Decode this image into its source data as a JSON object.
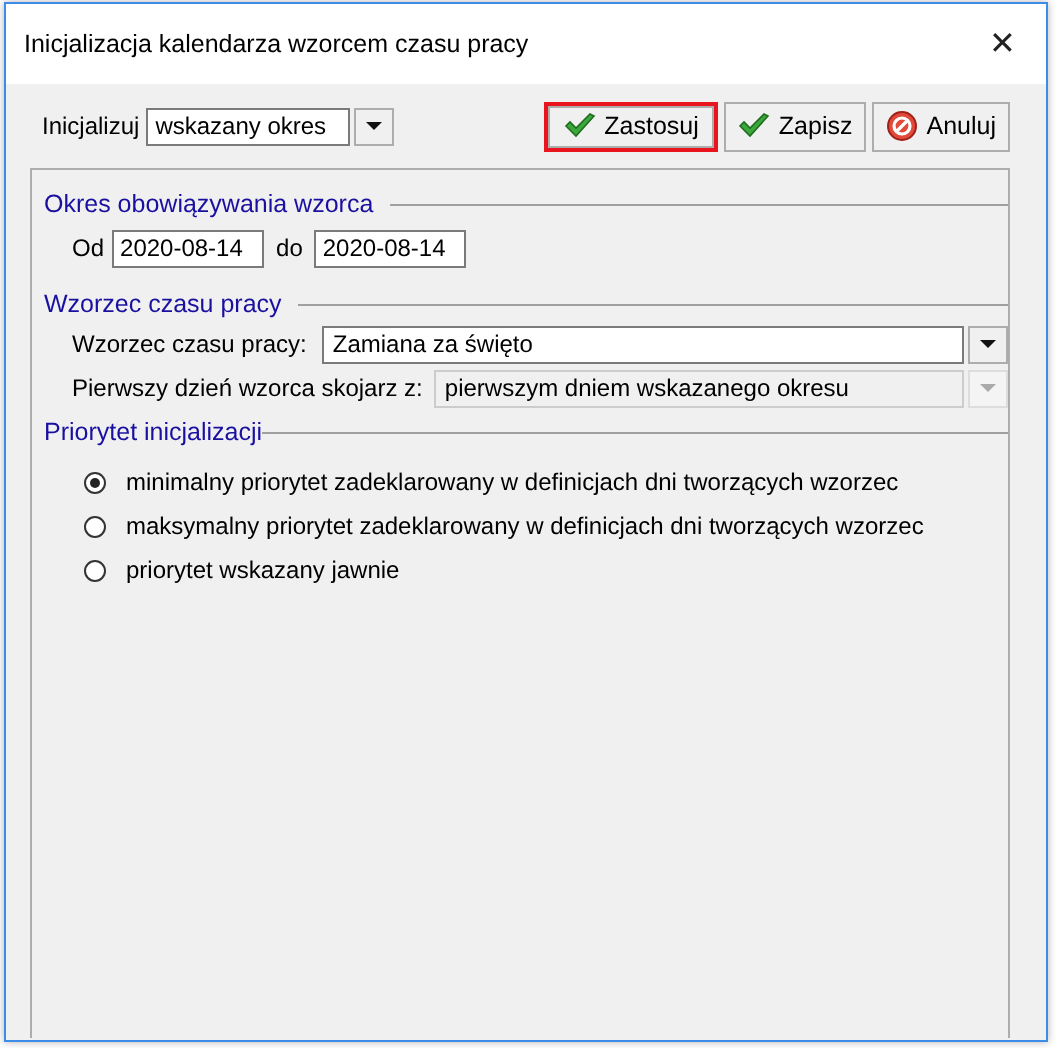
{
  "window": {
    "title": "Inicjalizacja kalendarza wzorcem czasu pracy",
    "close": "✕"
  },
  "init": {
    "label": "Inicjalizuj",
    "value": "wskazany okres"
  },
  "buttons": [
    {
      "kind": "ok",
      "label": "Zastosuj",
      "highlighted": true
    },
    {
      "kind": "ok",
      "label": "Zapisz",
      "highlighted": false
    },
    {
      "kind": "cancel",
      "label": "Anuluj",
      "highlighted": false
    }
  ],
  "period": {
    "title": "Okres obowiązywania wzorca",
    "from_label": "Od",
    "from": "2020-08-14",
    "to_label": "do",
    "to": "2020-08-14"
  },
  "pattern": {
    "title": "Wzorzec czasu pracy",
    "fields": [
      {
        "label": "Wzorzec czasu pracy:",
        "value": "Zamiana za święto",
        "disabled": false
      },
      {
        "label": "Pierwszy dzień wzorca skojarz z:",
        "value": "pierwszym dniem wskazanego okresu",
        "disabled": true
      }
    ]
  },
  "priority": {
    "title": "Priorytet inicjalizacji",
    "options": [
      {
        "label": "minimalny priorytet zadeklarowany w definicjach dni tworzących wzorzec",
        "selected": true
      },
      {
        "label": "maksymalny priorytet zadeklarowany w definicjach dni tworzących wzorzec",
        "selected": false
      },
      {
        "label": "priorytet wskazany jawnie",
        "selected": false
      }
    ]
  }
}
